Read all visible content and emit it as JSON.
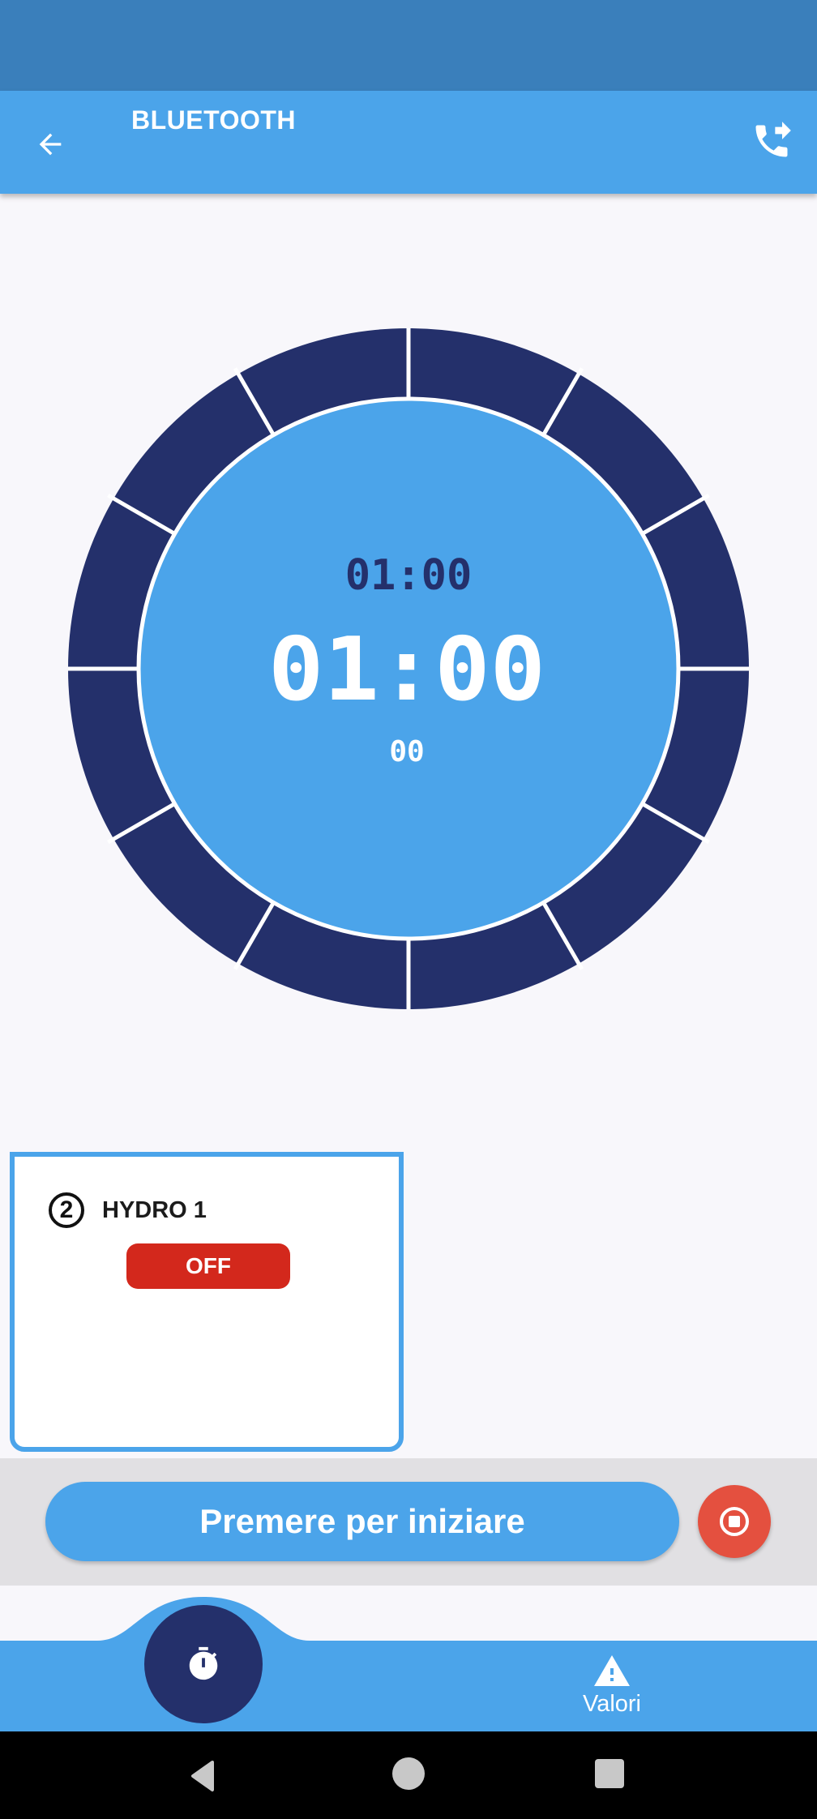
{
  "app_bar": {
    "title": "BLUETOOTH",
    "back_icon": "arrow-left-icon",
    "call_icon": "phone-forward-icon"
  },
  "timer": {
    "top_time": "01:00",
    "main_time": "01:00",
    "sub_time": "00",
    "colors": {
      "ring": "#24306b",
      "face": "#4ba4ea",
      "divider": "#ffffff",
      "top_time": "#24306b",
      "main_time": "#ffffff"
    }
  },
  "hydro_card": {
    "number": "2",
    "name": "HYDRO 1",
    "status": "OFF",
    "status_color": "#d3281c",
    "border_color": "#4ba4ea"
  },
  "actions": {
    "start_label": "Premere per iniziare",
    "stop_icon": "stop-circle-icon",
    "stop_color": "#e4503f"
  },
  "bottom_nav": {
    "timer_icon": "stopwatch-icon",
    "valori_label": "Valori",
    "valori_icon": "warning-triangle-icon"
  },
  "system_nav": {
    "back_icon": "nav-back-icon",
    "home_icon": "nav-home-icon",
    "recent_icon": "nav-recent-icon"
  }
}
